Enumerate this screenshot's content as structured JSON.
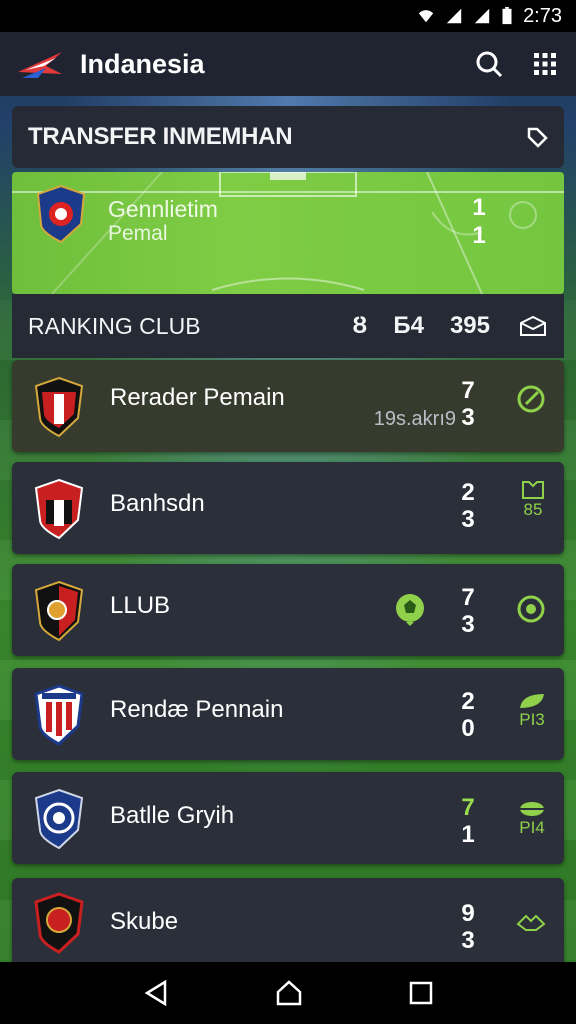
{
  "status": {
    "time": "2:73"
  },
  "app": {
    "title": "Indanesia"
  },
  "transfer": {
    "title": "TRANSFER INMEMHAN"
  },
  "featured": {
    "name": "Gennlietim",
    "sub": "Pemal",
    "score_top": "1",
    "score_bottom": "1"
  },
  "ranking": {
    "title": "RANKING CLUB",
    "stats": [
      "Ȣ",
      "Ƃ4",
      "395"
    ]
  },
  "clubs": [
    {
      "name": "Rerader Pemain",
      "extra": "19s.akrı9",
      "score_top": "7",
      "score_bottom": "3",
      "action": ""
    },
    {
      "name": "Banhsdn",
      "extra": "",
      "score_top": "2",
      "score_bottom": "3",
      "action": "85"
    },
    {
      "name": "LLUB",
      "extra": "",
      "score_top": "7",
      "score_bottom": "3",
      "action": ""
    },
    {
      "name": "Rendæ Pennain",
      "extra": "",
      "score_top": "2",
      "score_bottom": "0",
      "action": "PI3"
    },
    {
      "name": "Batlle Gryih",
      "extra": "",
      "score_top": "7",
      "score_bottom": "1",
      "action": "PI4"
    },
    {
      "name": "Skube",
      "extra": "",
      "score_top": "9",
      "score_bottom": "3",
      "action": ""
    }
  ],
  "colors": {
    "accent": "#8fd14a",
    "card": "#2a2f3a",
    "appbar": "#1f2430"
  }
}
